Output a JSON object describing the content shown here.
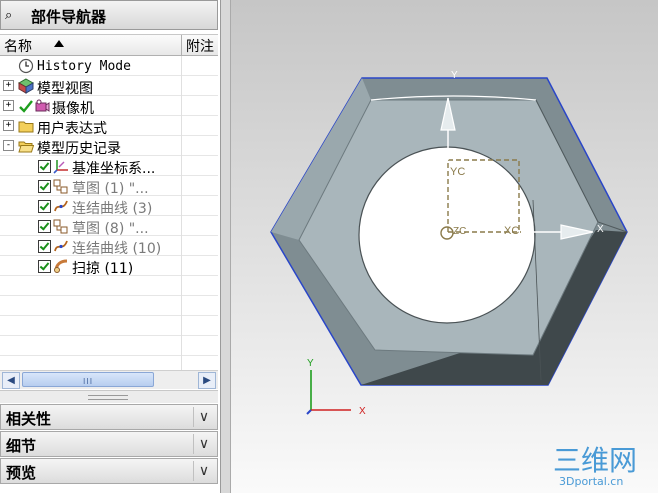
{
  "navigator": {
    "title": "部件导航器",
    "columns": {
      "name": "名称",
      "notes": "附注"
    },
    "rows": [
      {
        "label": "History Mode",
        "icon": "history-clock-icon",
        "expand": "",
        "checked": false,
        "grey": false
      },
      {
        "label": "模型视图",
        "icon": "model-views-icon",
        "expand": "+",
        "checked": false,
        "grey": false
      },
      {
        "label": "摄像机",
        "icon": "camera-icon",
        "expand": "+",
        "checked": false,
        "grey": false
      },
      {
        "label": "用户表达式",
        "icon": "folder-icon",
        "expand": "+",
        "checked": false,
        "grey": false
      },
      {
        "label": "模型历史记录",
        "icon": "folder-open-icon",
        "expand": "-",
        "checked": false,
        "grey": false
      },
      {
        "label": "基准坐标系...",
        "icon": "datum-csys-icon",
        "expand": "",
        "checked": true,
        "grey": false
      },
      {
        "label": "草图 (1) \"...",
        "icon": "sketch-icon",
        "expand": "",
        "checked": true,
        "grey": true
      },
      {
        "label": "连结曲线 (3)",
        "icon": "joined-curve-icon",
        "expand": "",
        "checked": true,
        "grey": true
      },
      {
        "label": "草图 (8) \"...",
        "icon": "sketch-icon",
        "expand": "",
        "checked": true,
        "grey": true
      },
      {
        "label": "连结曲线 (10)",
        "icon": "joined-curve-icon",
        "expand": "",
        "checked": true,
        "grey": true
      },
      {
        "label": "扫掠 (11)",
        "icon": "sweep-icon",
        "expand": "",
        "checked": true,
        "grey": false
      }
    ],
    "scrollbar_grip": "III"
  },
  "sections": [
    {
      "label": "相关性"
    },
    {
      "label": "细节"
    },
    {
      "label": "预览"
    }
  ],
  "viewport": {
    "csys_labels": {
      "yc": "YC",
      "xc": "XC",
      "zc": "ZC",
      "x_handle": "X",
      "y_handle": "Y"
    },
    "triad_labels": {
      "x": "X",
      "y": "Y"
    },
    "watermark": {
      "logo": "三维网",
      "site": "3Dportal.cn"
    },
    "colors": {
      "nut_face": "#a9b6bb",
      "nut_side_light": "#8c9a9f",
      "nut_side_dark": "#3d4547",
      "edge": "#2a46c8"
    }
  }
}
